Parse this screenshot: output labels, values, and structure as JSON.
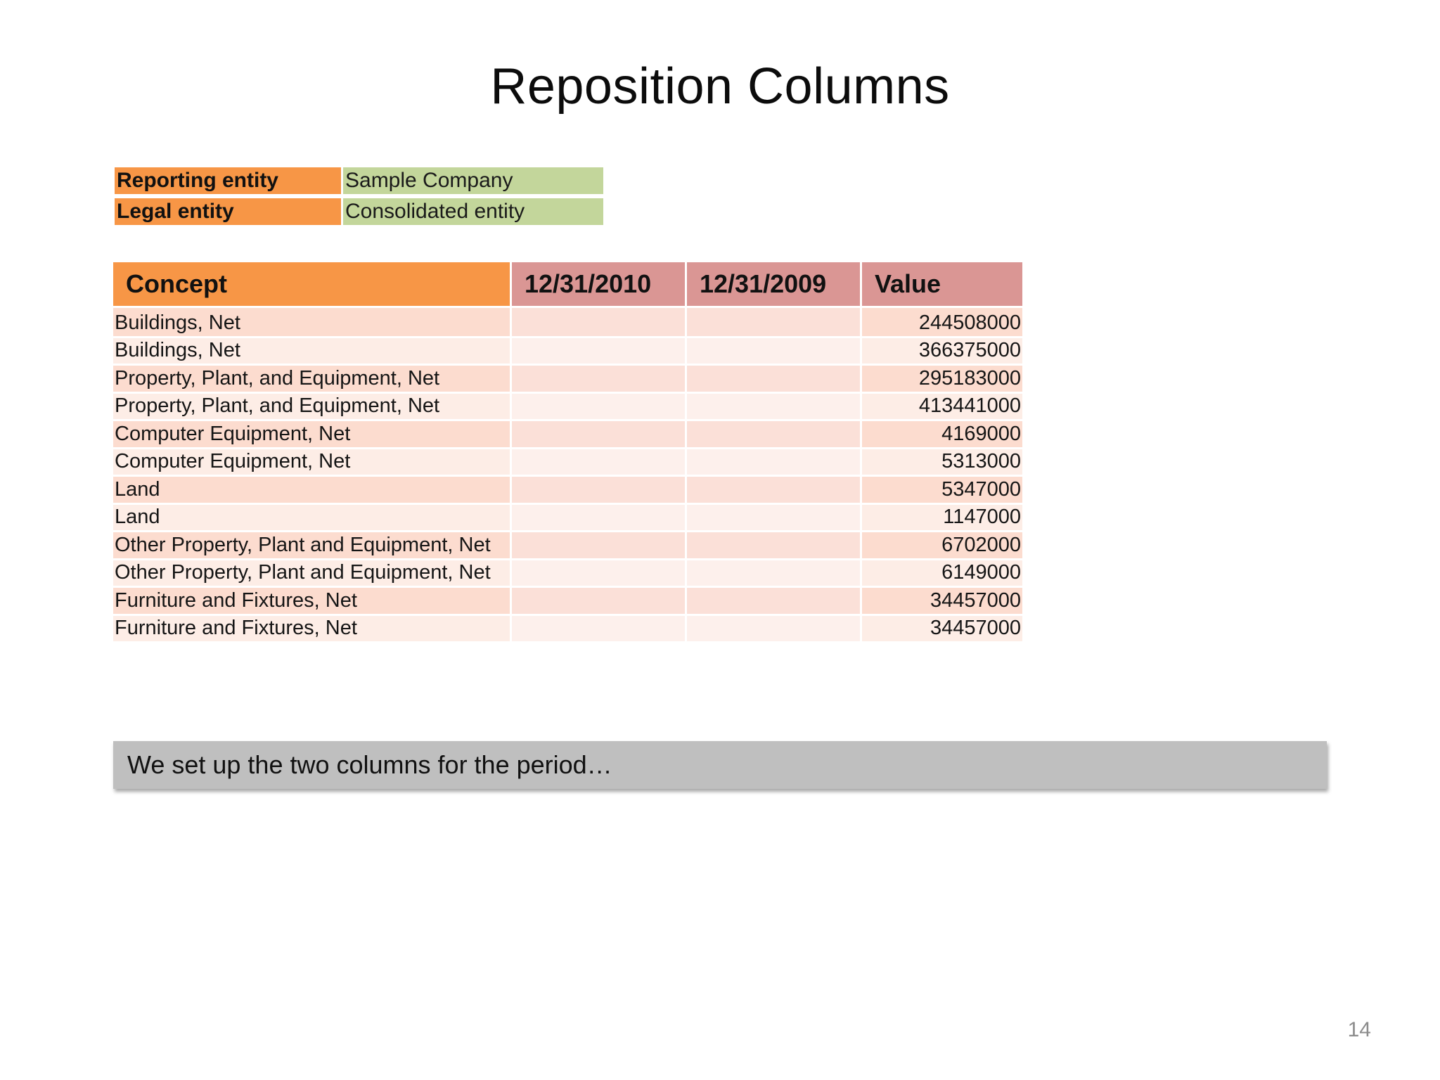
{
  "slide": {
    "title": "Reposition Columns",
    "page_number": "14"
  },
  "entities": [
    {
      "label": "Reporting entity",
      "value": "Sample Company"
    },
    {
      "label": "Legal entity",
      "value": "Consolidated entity"
    }
  ],
  "table": {
    "headers": {
      "concept": "Concept",
      "date1": "12/31/2010",
      "date2": "12/31/2009",
      "value": "Value"
    },
    "rows": [
      {
        "concept": "Buildings, Net",
        "date1": "",
        "date2": "",
        "value": "244508000"
      },
      {
        "concept": "Buildings, Net",
        "date1": "",
        "date2": "",
        "value": "366375000"
      },
      {
        "concept": "Property, Plant, and Equipment, Net",
        "date1": "",
        "date2": "",
        "value": "295183000"
      },
      {
        "concept": "Property, Plant, and Equipment, Net",
        "date1": "",
        "date2": "",
        "value": "413441000"
      },
      {
        "concept": "Computer Equipment, Net",
        "date1": "",
        "date2": "",
        "value": "4169000"
      },
      {
        "concept": "Computer Equipment, Net",
        "date1": "",
        "date2": "",
        "value": "5313000"
      },
      {
        "concept": "Land",
        "date1": "",
        "date2": "",
        "value": "5347000"
      },
      {
        "concept": "Land",
        "date1": "",
        "date2": "",
        "value": "1147000"
      },
      {
        "concept": "Other Property, Plant and Equipment, Net",
        "date1": "",
        "date2": "",
        "value": "6702000"
      },
      {
        "concept": "Other Property, Plant and Equipment, Net",
        "date1": "",
        "date2": "",
        "value": "6149000"
      },
      {
        "concept": "Furniture and Fixtures, Net",
        "date1": "",
        "date2": "",
        "value": "34457000"
      },
      {
        "concept": "Furniture and Fixtures, Net",
        "date1": "",
        "date2": "",
        "value": "34457000"
      }
    ]
  },
  "callout": {
    "text": "We set up the two columns for the period…"
  }
}
